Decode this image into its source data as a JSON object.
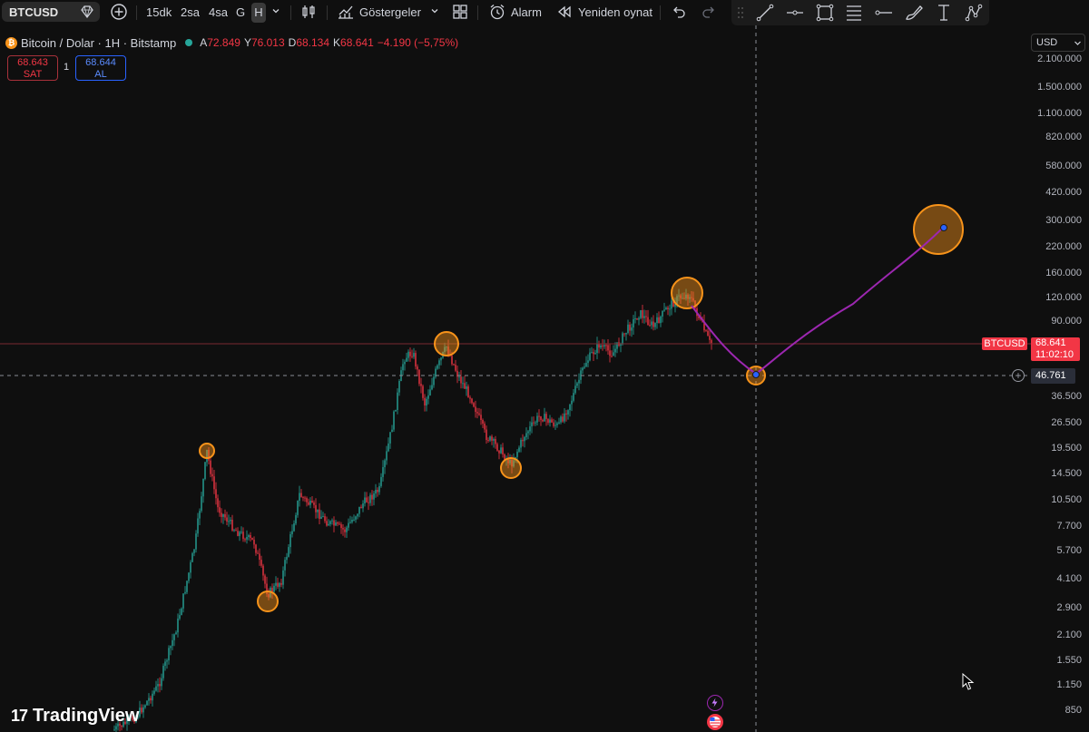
{
  "toolbar": {
    "symbol": "BTCUSD",
    "intervals": [
      "15dk",
      "2sa",
      "4sa",
      "G",
      "H"
    ],
    "active_interval": "H",
    "indicators_label": "Göstergeler",
    "alarm_label": "Alarm",
    "replay_label": "Yeniden oynat"
  },
  "legend": {
    "title": "Bitcoin / Dolar · 1H · Bitstamp",
    "o_label": "A",
    "o_value": "72.849",
    "h_label": "Y",
    "h_value": "76.013",
    "l_label": "D",
    "l_value": "68.134",
    "c_label": "K",
    "c_value": "68.641",
    "change": "−4.190 (−5,75%)"
  },
  "trade": {
    "sell_price": "68.643",
    "sell_label": "SAT",
    "qty": "1",
    "buy_price": "68.644",
    "buy_label": "AL"
  },
  "price_axis": {
    "currency": "USD",
    "labels": [
      "2.100.000",
      "1.500.000",
      "1.100.000",
      "820.000",
      "580.000",
      "420.000",
      "300.000",
      "220.000",
      "160.000",
      "120.000",
      "90.000",
      "36.500",
      "26.500",
      "19.500",
      "14.500",
      "10.500",
      "7.700",
      "5.700",
      "4.100",
      "2.900",
      "2.100",
      "1.550",
      "1.150",
      "850"
    ],
    "current_symbol": "BTCUSD",
    "current_price": "68.641",
    "countdown": "11:02:10",
    "crosshair_price": "46.761"
  },
  "brand": "TradingView",
  "colors": {
    "background": "#0f0f0f",
    "up": "#26a69a",
    "down": "#f23645",
    "marker": "#f7931a",
    "projection": "#9c27b0"
  },
  "icons": {
    "event_flash": "flash-icon",
    "event_flag": "us-flag-icon"
  }
}
